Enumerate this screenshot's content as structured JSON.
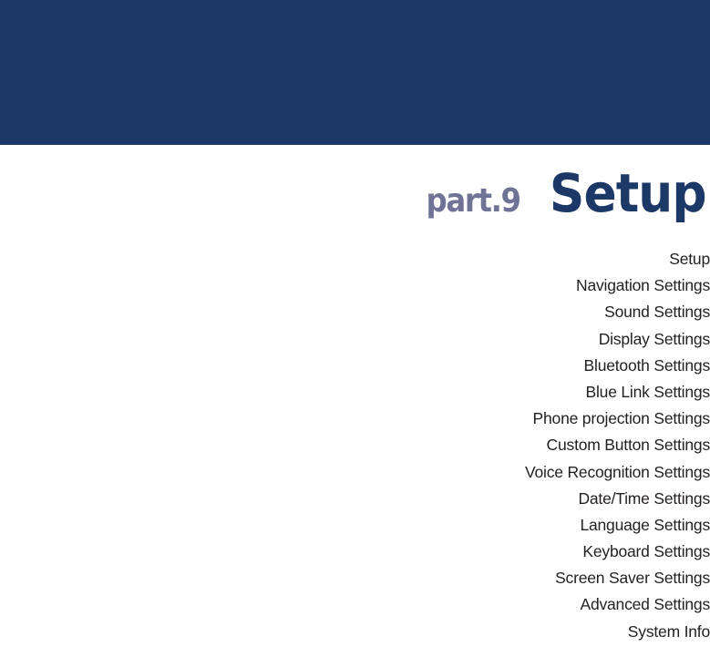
{
  "header": {
    "band_color": "#1b3866"
  },
  "title": {
    "part_label": "part.9",
    "chapter": "Setup",
    "part_color": "#6f7395",
    "chapter_color": "#1b3866"
  },
  "toc": {
    "items": [
      {
        "label": "Setup"
      },
      {
        "label": "Navigation Settings"
      },
      {
        "label": "Sound Settings"
      },
      {
        "label": "Display Settings"
      },
      {
        "label": "Bluetooth Settings"
      },
      {
        "label": "Blue Link Settings"
      },
      {
        "label": "Phone projection Settings"
      },
      {
        "label": "Custom Button Settings"
      },
      {
        "label": "Voice Recognition Settings"
      },
      {
        "label": "Date/Time Settings"
      },
      {
        "label": "Language Settings"
      },
      {
        "label": "Keyboard Settings"
      },
      {
        "label": "Screen Saver Settings"
      },
      {
        "label": "Advanced Settings"
      },
      {
        "label": "System Info"
      }
    ]
  }
}
